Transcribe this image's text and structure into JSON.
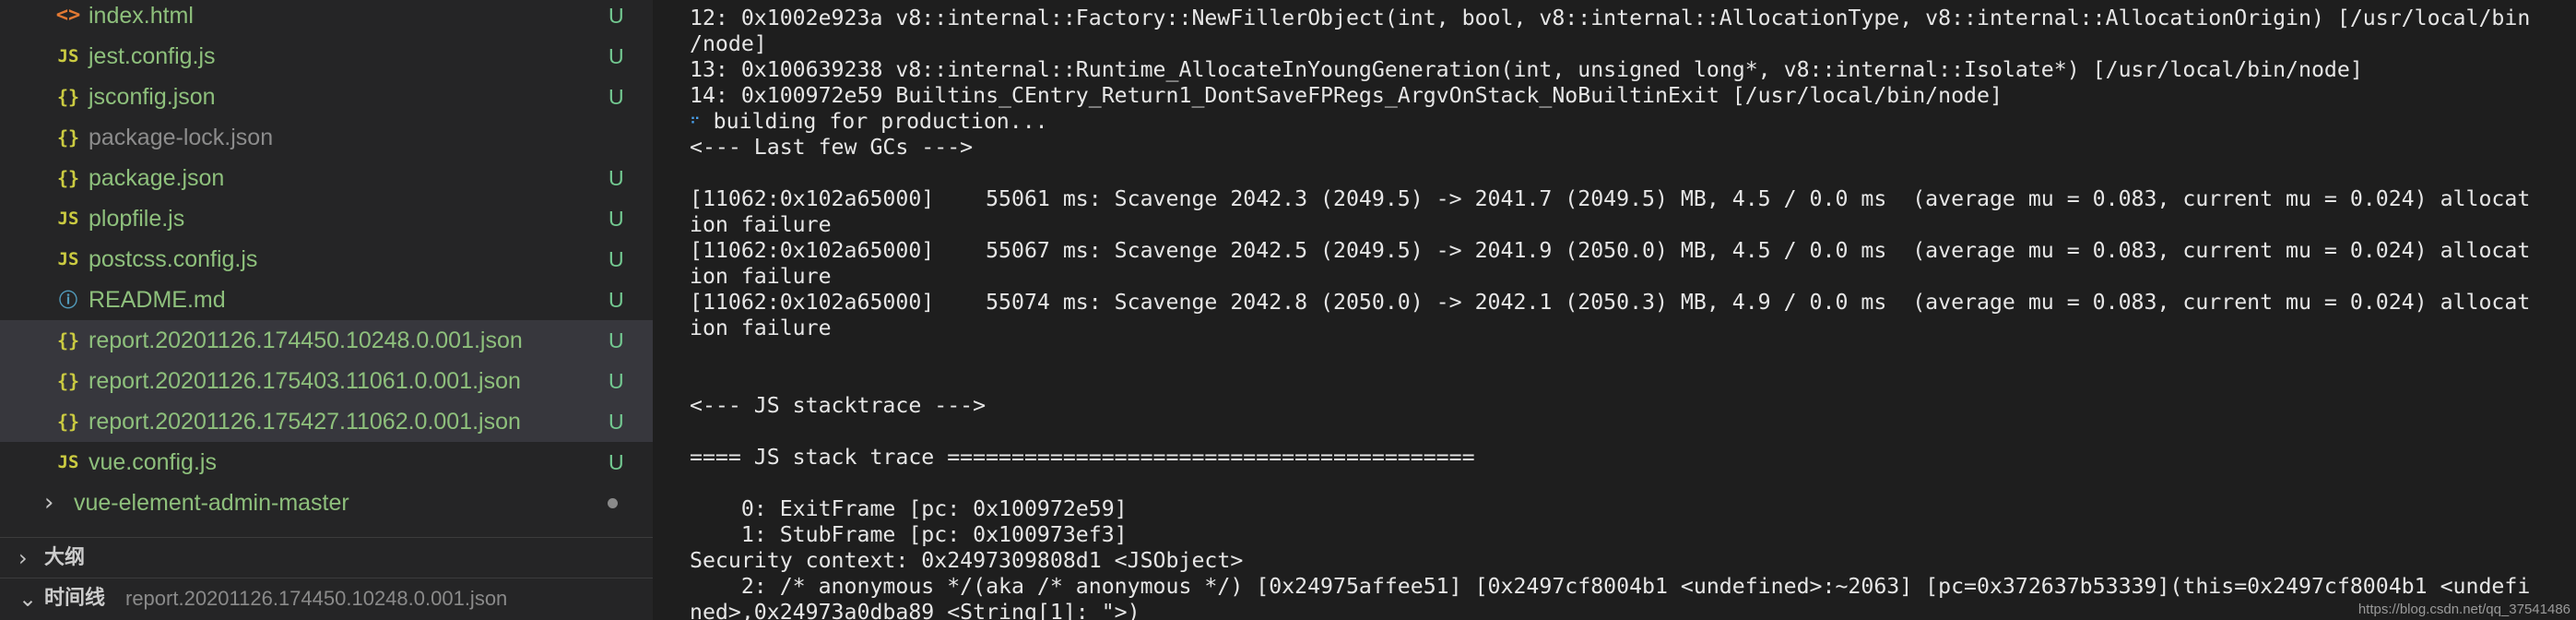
{
  "explorer": {
    "files": [
      {
        "name": "index.html",
        "icon": "html-icon",
        "status": "U",
        "color": "#8ec07c"
      },
      {
        "name": "jest.config.js",
        "icon": "js-icon",
        "status": "U",
        "color": "#8ec07c"
      },
      {
        "name": "jsconfig.json",
        "icon": "json-icon",
        "status": "U",
        "color": "#8ec07c"
      },
      {
        "name": "package-lock.json",
        "icon": "json-icon",
        "status": "",
        "color": "#8c8c8c"
      },
      {
        "name": "package.json",
        "icon": "json-icon",
        "status": "U",
        "color": "#8ec07c"
      },
      {
        "name": "plopfile.js",
        "icon": "js-icon",
        "status": "U",
        "color": "#8ec07c"
      },
      {
        "name": "postcss.config.js",
        "icon": "js-icon",
        "status": "U",
        "color": "#8ec07c"
      },
      {
        "name": "README.md",
        "icon": "info-icon",
        "status": "U",
        "color": "#8ec07c"
      },
      {
        "name": "report.20201126.174450.10248.0.001.json",
        "icon": "json-icon",
        "status": "U",
        "color": "#8ec07c",
        "selected": true
      },
      {
        "name": "report.20201126.175403.11061.0.001.json",
        "icon": "json-icon",
        "status": "U",
        "color": "#8ec07c",
        "selected": true
      },
      {
        "name": "report.20201126.175427.11062.0.001.json",
        "icon": "json-icon",
        "status": "U",
        "color": "#8ec07c",
        "selected": true
      },
      {
        "name": "vue.config.js",
        "icon": "js-icon",
        "status": "U",
        "color": "#8ec07c"
      }
    ],
    "folder": {
      "name": "vue-element-admin-master",
      "color": "#8ec07c"
    },
    "outline_section": {
      "title": "大纲"
    },
    "timeline_section": {
      "title": "时间线",
      "file": "report.20201126.174450.10248.0.001.json"
    }
  },
  "terminal": {
    "lines": [
      "12: 0x1002e923a v8::internal::Factory::NewFillerObject(int, bool, v8::internal::AllocationType, v8::internal::AllocationOrigin) [/usr/local/bin",
      "/node]",
      "13: 0x100639238 v8::internal::Runtime_AllocateInYoungGeneration(int, unsigned long*, v8::internal::Isolate*) [/usr/local/bin/node]",
      "14: 0x100972e59 Builtins_CEntry_Return1_DontSaveFPRegs_ArgvOnStack_NoBuiltinExit [/usr/local/bin/node]",
      " building for production...",
      "<--- Last few GCs --->",
      "",
      "[11062:0x102a65000]    55061 ms: Scavenge 2042.3 (2049.5) -> 2041.7 (2049.5) MB, 4.5 / 0.0 ms  (average mu = 0.083, current mu = 0.024) allocat",
      "ion failure",
      "[11062:0x102a65000]    55067 ms: Scavenge 2042.5 (2049.5) -> 2041.9 (2050.0) MB, 4.5 / 0.0 ms  (average mu = 0.083, current mu = 0.024) allocat",
      "ion failure",
      "[11062:0x102a65000]    55074 ms: Scavenge 2042.8 (2050.0) -> 2042.1 (2050.3) MB, 4.9 / 0.0 ms  (average mu = 0.083, current mu = 0.024) allocat",
      "ion failure",
      "",
      "",
      "<--- JS stacktrace --->",
      "",
      "==== JS stack trace =========================================",
      "",
      "    0: ExitFrame [pc: 0x100972e59]",
      "    1: StubFrame [pc: 0x100973ef3]",
      "Security context: 0x2497309808d1 <JSObject>",
      "    2: /* anonymous */(aka /* anonymous */) [0x24975affee51] [0x2497cf8004b1 <undefined>:~2063] [pc=0x372637b53339](this=0x2497cf8004b1 <undefi",
      "ned>,0x24973a0dba89 <String[1]: \">)"
    ],
    "spinner_glyph": "⠋",
    "watermark": "https://blog.csdn.net/qq_37541486"
  }
}
